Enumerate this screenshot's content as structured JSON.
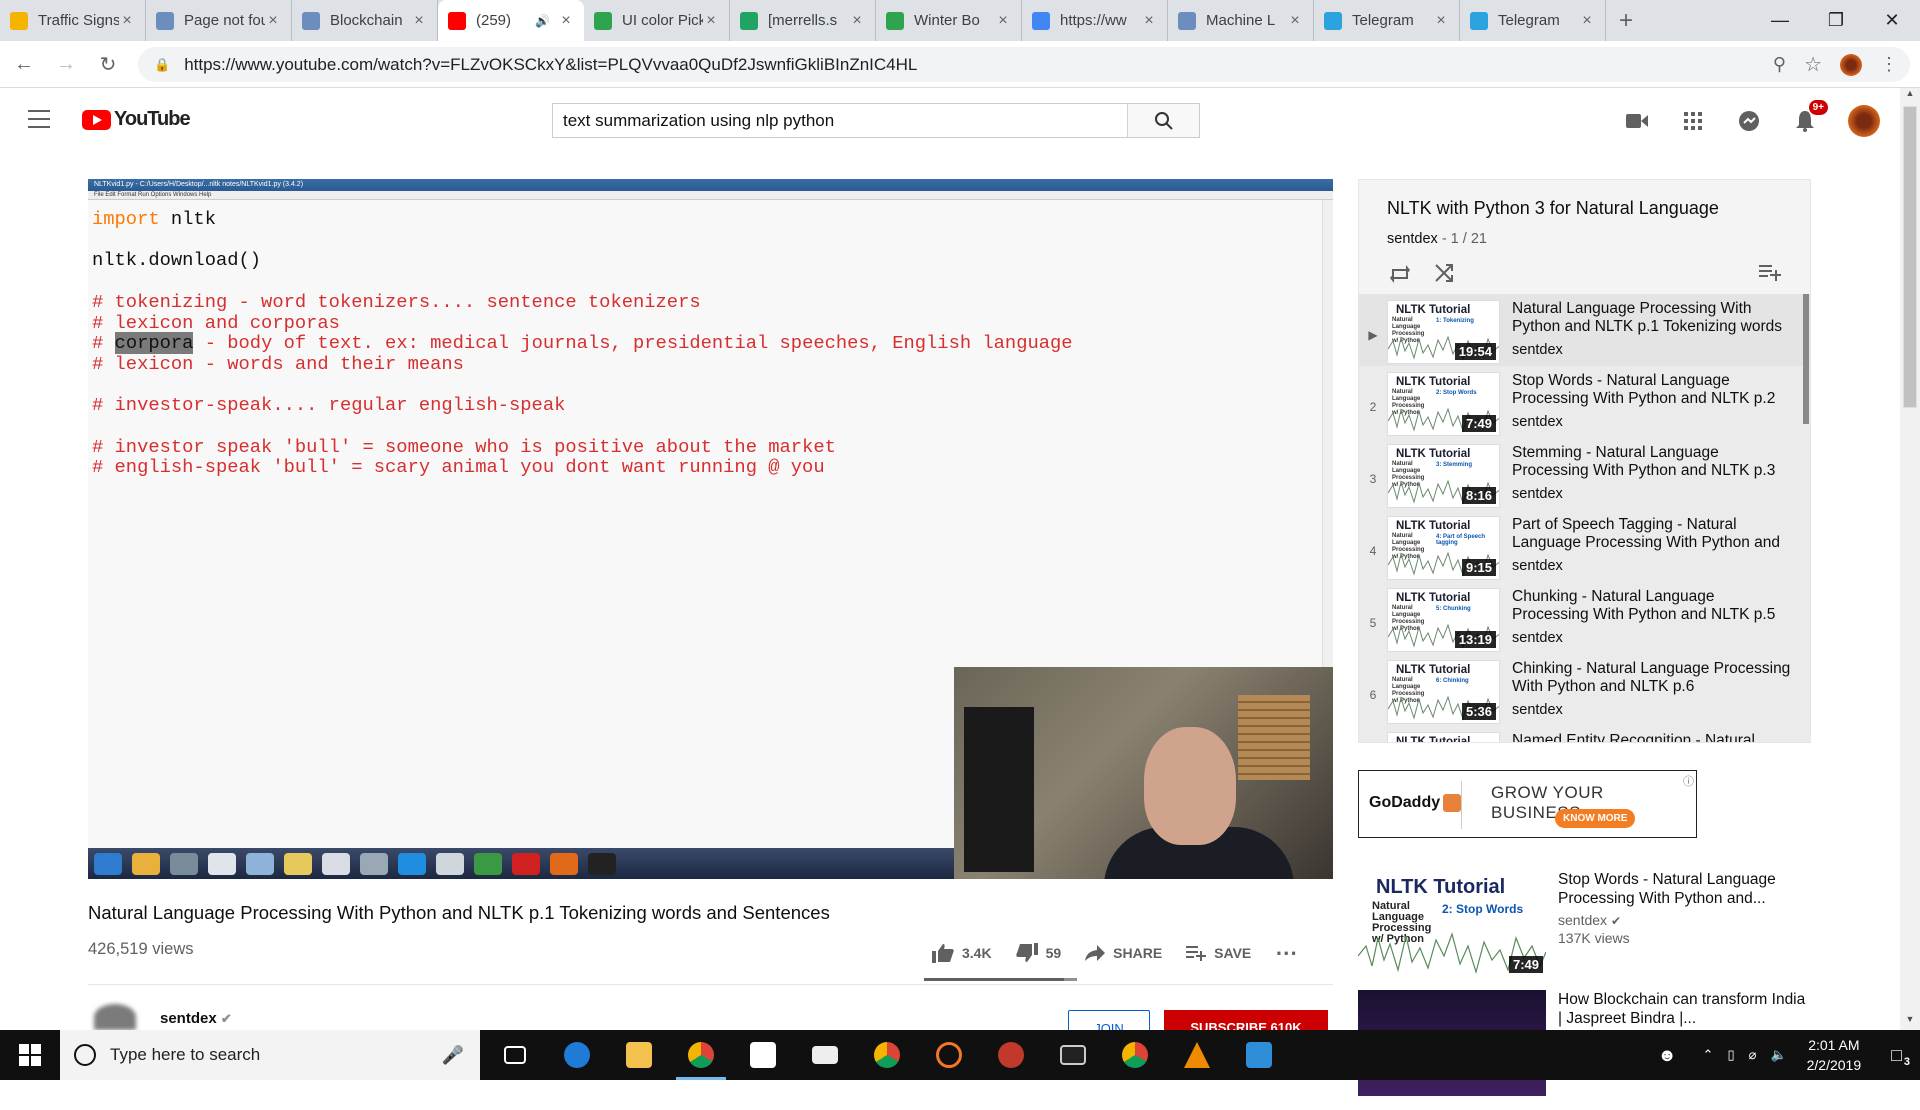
{
  "browser": {
    "tabs": [
      {
        "title": "Traffic Signs",
        "favicon_color": "#f5b400",
        "favicon": "co-icon"
      },
      {
        "title": "Page not found",
        "favicon_color": "#6c8ebf",
        "favicon": "bird-icon"
      },
      {
        "title": "Blockchain",
        "favicon_color": "#6c8ebf",
        "favicon": "bird-icon"
      },
      {
        "title": "(259)",
        "favicon_color": "#ff0000",
        "favicon": "youtube-icon",
        "active": true
      },
      {
        "title": "UI color Picker",
        "favicon_color": "#2ea44f",
        "favicon": "play-icon"
      },
      {
        "title": "[merrells.s",
        "favicon_color": "#1fa463",
        "favicon": "drive-icon"
      },
      {
        "title": "Winter Bo",
        "favicon_color": "#2ea44f",
        "favicon": "play-icon"
      },
      {
        "title": "https://ww",
        "favicon_color": "#4285f4",
        "favicon": "google-icon"
      },
      {
        "title": "Machine L",
        "favicon_color": "#6c8ebf",
        "favicon": "bird-icon"
      },
      {
        "title": "Telegram",
        "favicon_color": "#2aa3df",
        "favicon": "telegram-icon"
      },
      {
        "title": "Telegram",
        "favicon_color": "#2aa3df",
        "favicon": "telegram-icon"
      }
    ],
    "url": "https://www.youtube.com/watch?v=FLZvOKSCkxY&list=PLQVvvaa0QuDf2JswnfiGkliBInZnIC4HL"
  },
  "masthead": {
    "logo_text": "YouTube",
    "search_value": "text summarization using nlp python",
    "notification_count": "9+"
  },
  "video": {
    "editor_title": "NLTKvid1.py - C:/Users/H/Desktop/...nltk notes/NLTKvid1.py (3.4.2)",
    "editor_menu": "File   Edit   Format   Run   Options   Windows   Help",
    "code": {
      "l1_kw": "import",
      "l1_rest": " nltk",
      "l3": "nltk.download()",
      "l5": "# tokenizing - word tokenizers.... sentence tokenizers",
      "l6": "# lexicon and corporas",
      "l7_pre": "# ",
      "l7_sel": "corpora",
      "l7_post": " - body of text. ex: medical journals, presidential speeches, English language",
      "l8": "# lexicon - words and their means",
      "l10": "# investor-speak.... regular english-speak",
      "l12": "# investor speak 'bull' = someone who is positive about the market",
      "l13": "# english-speak 'bull' = scary animal you dont want running @ you"
    },
    "title": "Natural Language Processing With Python and NLTK p.1 Tokenizing words and Sentences",
    "views": "426,519 views",
    "likes": "3.4K",
    "dislikes": "59",
    "share_label": "SHARE",
    "save_label": "SAVE",
    "channel": "sentdex",
    "join_label": "JOIN",
    "subscribe_label": "SUBSCRIBE 610K"
  },
  "playlist": {
    "title": "NLTK with Python 3 for Natural Language",
    "owner": "sentdex",
    "position": " - 1 / 21",
    "items": [
      {
        "idx": "▶",
        "thumb_sub": "1: Tokenizing",
        "duration": "19:54",
        "title": "Natural Language Processing With Python and NLTK p.1 Tokenizing words",
        "channel": "sentdex"
      },
      {
        "idx": "2",
        "thumb_sub": "2: Stop Words",
        "duration": "7:49",
        "title": "Stop Words - Natural Language Processing With Python and NLTK p.2",
        "channel": "sentdex"
      },
      {
        "idx": "3",
        "thumb_sub": "3: Stemming",
        "duration": "8:16",
        "title": "Stemming - Natural Language Processing With Python and NLTK p.3",
        "channel": "sentdex"
      },
      {
        "idx": "4",
        "thumb_sub": "4: Part of Speech tagging",
        "duration": "9:15",
        "title": "Part of Speech Tagging - Natural Language Processing With Python and",
        "channel": "sentdex"
      },
      {
        "idx": "5",
        "thumb_sub": "5: Chunking",
        "duration": "13:19",
        "title": "Chunking - Natural Language Processing With Python and NLTK p.5",
        "channel": "sentdex"
      },
      {
        "idx": "6",
        "thumb_sub": "6: Chinking",
        "duration": "5:36",
        "title": "Chinking - Natural Language Processing With Python and NLTK p.6",
        "channel": "sentdex"
      },
      {
        "idx": "7",
        "thumb_sub": "",
        "duration": "",
        "title": "Named Entity Recognition - Natural",
        "channel": ""
      }
    ],
    "thumb_title": "NLTK Tutorial",
    "thumb_side": "Natural Language Processing w/ Python"
  },
  "ad": {
    "brand": "GoDaddy",
    "headline": "GROW YOUR BUSINESS",
    "cta": "KNOW MORE",
    "info": "ⓘ"
  },
  "upnext": [
    {
      "thumb_title": "NLTK Tutorial",
      "thumb_side": "Natural Language Processing w/ Python",
      "thumb_sub": "2: Stop Words",
      "duration": "7:49",
      "title": "Stop Words - Natural Language Processing With Python and...",
      "channel": "sentdex",
      "views": "137K views"
    },
    {
      "title": "How Blockchain can transform India | Jaspreet Bindra |..."
    }
  ],
  "taskbar": {
    "search_placeholder": "Type here to search",
    "time": "2:01 AM",
    "date": "2/2/2019",
    "notifications": "3"
  }
}
